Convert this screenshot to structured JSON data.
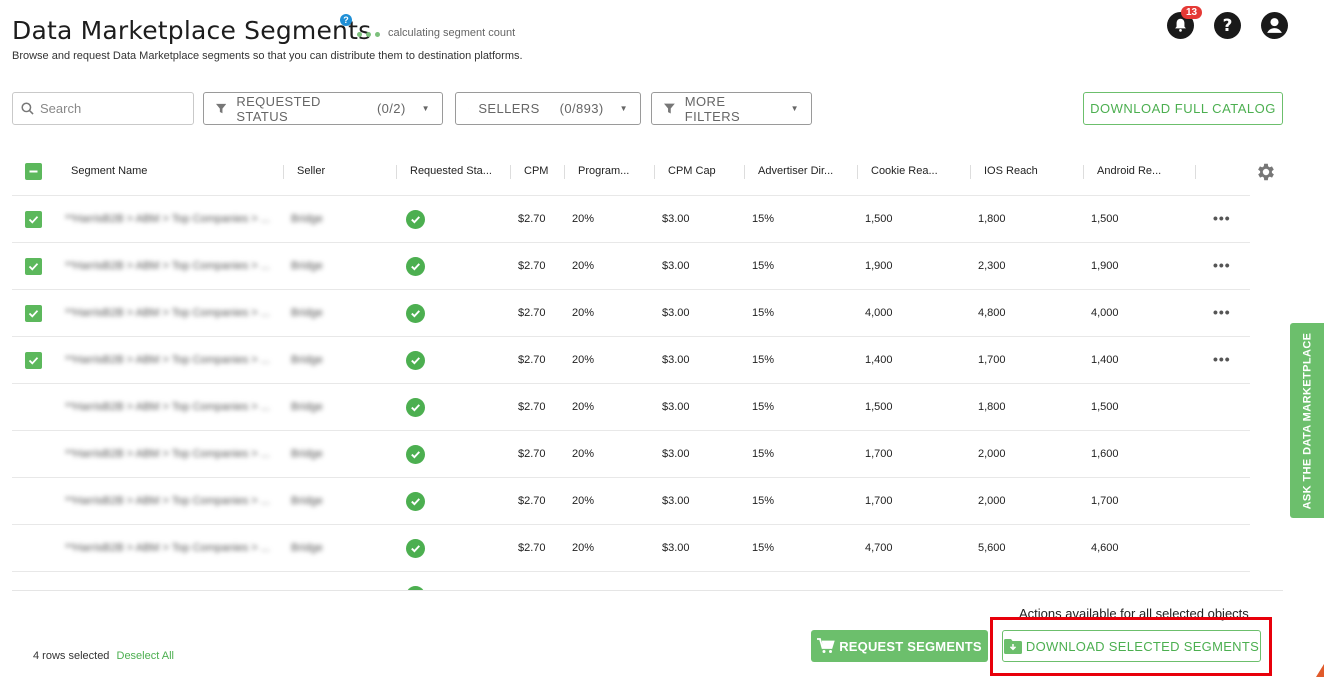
{
  "header": {
    "title": "Data Marketplace Segments",
    "help_symbol": "?",
    "loading_text": "calculating segment count",
    "subtitle": "Browse and request Data Marketplace segments so that you can distribute them to destination platforms.",
    "notification_count": "13"
  },
  "toolbar": {
    "search_placeholder": "Search",
    "filters": [
      {
        "label": "REQUESTED STATUS",
        "count": "(0/2)"
      },
      {
        "label": "SELLERS",
        "count": "(0/893)"
      },
      {
        "label": "MORE FILTERS",
        "count": ""
      }
    ],
    "download_catalog_label": "DOWNLOAD FULL CATALOG"
  },
  "table": {
    "columns": [
      "Segment Name",
      "Seller",
      "Requested Sta...",
      "CPM",
      "Program...",
      "CPM Cap",
      "Advertiser Dir...",
      "Cookie Rea...",
      "IOS Reach",
      "Android Re..."
    ],
    "rows": [
      {
        "selected": true,
        "name": "**HarrisB2B > ABM > Top Companies > ...",
        "seller": "Bridge",
        "cpm": "$2.70",
        "program": "20%",
        "cpm_cap": "$3.00",
        "adv": "15%",
        "cookie": "1,500",
        "ios": "1,800",
        "android": "1,500"
      },
      {
        "selected": true,
        "name": "**HarrisB2B > ABM > Top Companies > ...",
        "seller": "Bridge",
        "cpm": "$2.70",
        "program": "20%",
        "cpm_cap": "$3.00",
        "adv": "15%",
        "cookie": "1,900",
        "ios": "2,300",
        "android": "1,900"
      },
      {
        "selected": true,
        "name": "**HarrisB2B > ABM > Top Companies > ...",
        "seller": "Bridge",
        "cpm": "$2.70",
        "program": "20%",
        "cpm_cap": "$3.00",
        "adv": "15%",
        "cookie": "4,000",
        "ios": "4,800",
        "android": "4,000"
      },
      {
        "selected": true,
        "name": "**HarrisB2B > ABM > Top Companies > ...",
        "seller": "Bridge",
        "cpm": "$2.70",
        "program": "20%",
        "cpm_cap": "$3.00",
        "adv": "15%",
        "cookie": "1,400",
        "ios": "1,700",
        "android": "1,400"
      },
      {
        "selected": false,
        "name": "**HarrisB2B > ABM > Top Companies > ...",
        "seller": "Bridge",
        "cpm": "$2.70",
        "program": "20%",
        "cpm_cap": "$3.00",
        "adv": "15%",
        "cookie": "1,500",
        "ios": "1,800",
        "android": "1,500"
      },
      {
        "selected": false,
        "name": "**HarrisB2B > ABM > Top Companies > ...",
        "seller": "Bridge",
        "cpm": "$2.70",
        "program": "20%",
        "cpm_cap": "$3.00",
        "adv": "15%",
        "cookie": "1,700",
        "ios": "2,000",
        "android": "1,600"
      },
      {
        "selected": false,
        "name": "**HarrisB2B > ABM > Top Companies > ...",
        "seller": "Bridge",
        "cpm": "$2.70",
        "program": "20%",
        "cpm_cap": "$3.00",
        "adv": "15%",
        "cookie": "1,700",
        "ios": "2,000",
        "android": "1,700"
      },
      {
        "selected": false,
        "name": "**HarrisB2B > ABM > Top Companies > ...",
        "seller": "Bridge",
        "cpm": "$2.70",
        "program": "20%",
        "cpm_cap": "$3.00",
        "adv": "15%",
        "cookie": "4,700",
        "ios": "5,600",
        "android": "4,600"
      }
    ]
  },
  "side_tab": {
    "label": "ASK THE DATA MARKETPLACE"
  },
  "footer": {
    "actions_label": "Actions available for all selected objects",
    "rows_selected_text": "4 rows selected",
    "deselect_label": "Deselect All",
    "request_label": "REQUEST SEGMENTS",
    "download_selected_label": "DOWNLOAD SELECTED SEGMENTS"
  },
  "colors": {
    "accent": "#4caf50",
    "highlight": "#e8000b",
    "badge": "#e53935",
    "help": "#1f8fd6"
  },
  "icons": [
    "help-icon",
    "bell-icon",
    "question-icon",
    "user-icon",
    "search-icon",
    "funnel-icon",
    "chevron-down-icon",
    "checkbox-icon",
    "check-circle-icon",
    "more-icon",
    "gear-icon",
    "cart-icon",
    "folder-download-icon"
  ]
}
